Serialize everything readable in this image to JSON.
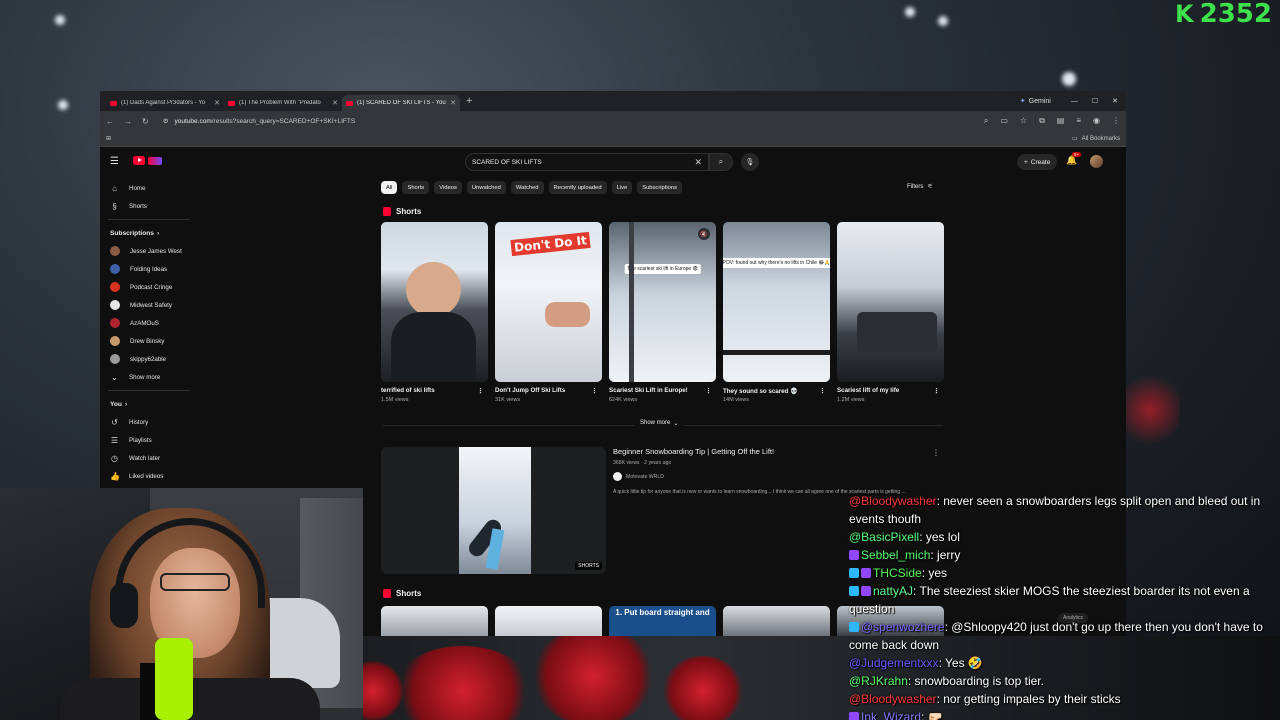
{
  "overlay": {
    "score_icon": "K",
    "score": "2352"
  },
  "browser": {
    "tabs": [
      {
        "title": "(1) Dads Against Pr3dators - Yo"
      },
      {
        "title": "(1) The Problem With \"Predato"
      },
      {
        "title": "(1) SCARED OF SKI LIFTS - YouT"
      }
    ],
    "gemini_label": "Gemini",
    "url_host": "youtube.com",
    "url_path": "/results?search_query=SCARED+OF+SKI+LIFTS",
    "all_bookmarks": "All Bookmarks"
  },
  "youtube": {
    "search_value": "SCARED OF SKI LIFTS",
    "create_label": "Create",
    "notif_count": "9+",
    "sidebar": {
      "main": [
        {
          "label": "Home",
          "icon": "home-icon"
        },
        {
          "label": "Shorts",
          "icon": "shorts-icon"
        }
      ],
      "subscriptions_title": "Subscriptions",
      "subscriptions": [
        {
          "label": "Jesse James West",
          "color": "#8a5a44"
        },
        {
          "label": "Folding Ideas",
          "color": "#3f5fa8"
        },
        {
          "label": "Podcast Cringe",
          "color": "#d8321f"
        },
        {
          "label": "Midwest Safety",
          "color": "#e6e6e6"
        },
        {
          "label": "AzAMOuS",
          "color": "#b02430"
        },
        {
          "label": "Drew Binsky",
          "color": "#c79a6e"
        },
        {
          "label": "skippy62able",
          "color": "#9c9c9c"
        }
      ],
      "show_more": "Show more",
      "you_title": "You",
      "you_items": [
        {
          "label": "History",
          "icon": "history-icon"
        },
        {
          "label": "Playlists",
          "icon": "playlists-icon"
        },
        {
          "label": "Watch later",
          "icon": "clock-icon"
        },
        {
          "label": "Liked videos",
          "icon": "thumbs-up-icon"
        }
      ]
    },
    "chips": [
      "All",
      "Shorts",
      "Videos",
      "Unwatched",
      "Watched",
      "Recently uploaded",
      "Live",
      "Subscriptions"
    ],
    "filters_label": "Filters",
    "shorts_title": "Shorts",
    "shorts": [
      {
        "title": "terrified of ski lifts",
        "views": "1.5M views",
        "overlay": ""
      },
      {
        "title": "Don't Jump Off Ski Lifts",
        "views": "31K views",
        "overlay": "Don't Do It"
      },
      {
        "title": "Scariest Ski Lift in Europe!",
        "views": "624K views",
        "overlay": "The scariest ski lift in Europe 😨"
      },
      {
        "title": "They sound so scared 💀",
        "views": "14M views",
        "overlay": "POV: found out why there's no lifts in Chile 😂🙏"
      },
      {
        "title": "Scariest lift of my life",
        "views": "1.2M views",
        "overlay": ""
      }
    ],
    "show_more_label": "Show more",
    "video": {
      "title": "Beginner Snowboarding Tip | Getting Off the Lift!",
      "meta": "368K views · 2 years ago",
      "channel": "Motovate WRLD",
      "description": "A quick little tip for anyone that is new or wants to learn snowboarding... I think we can all agree one of the scariest parts is getting ...",
      "tag": "SHORTS"
    },
    "shorts2_title": "Shorts",
    "shorts2_overlay": "1. Put board straight and"
  },
  "analytics_label": "Analytics",
  "chat": [
    {
      "user": "@Bloodywasher",
      "color": "#ff3a3a",
      "text": ": never seen a snowboarders legs split open and bleed out in events thoufh",
      "badges": []
    },
    {
      "user": "@BasicPixell",
      "color": "#5bff7a",
      "text": ": yes lol",
      "badges": []
    },
    {
      "user": "Sebbel_mich",
      "color": "#58ff6f",
      "text": ": jerry",
      "badges": [
        "#9146ff"
      ]
    },
    {
      "user": "THCSide",
      "color": "#55ff55",
      "text": ": yes",
      "badges": [
        "#2db7ff",
        "#9146ff"
      ]
    },
    {
      "user": "nattyAJ",
      "color": "#63ff8c",
      "text": ": The steeziest skier MOGS the steeziest boarder its not even a question",
      "badges": [
        "#2db7ff",
        "#9146ff"
      ]
    },
    {
      "user": "@spenwozhere",
      "color": "#7b6cff",
      "text": ": @Shloopy420 just don't go up there then you don't have to come back down",
      "badges": [
        "#2db7ff"
      ]
    },
    {
      "user": "@Judgementxxx",
      "color": "#6a58ff",
      "text": ": Yes 🤣",
      "badges": []
    },
    {
      "user": "@RJKrahn",
      "color": "#58ff6f",
      "text": ": snowboarding is top tier.",
      "badges": []
    },
    {
      "user": "@Bloodywasher",
      "color": "#ff3a3a",
      "text": ": nor getting impales by their sticks",
      "badges": []
    },
    {
      "user": "Ink_Wizard",
      "color": "#8a7cff",
      "text": ": 🤛🏻",
      "badges": [
        "#9146ff"
      ]
    }
  ]
}
